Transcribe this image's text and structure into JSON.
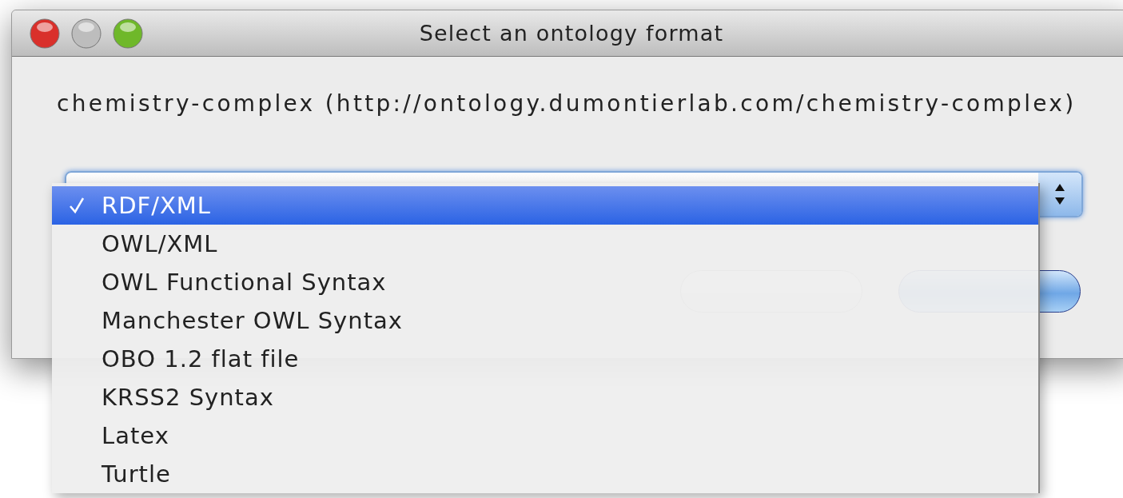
{
  "window": {
    "title": "Select an ontology format"
  },
  "description": "chemistry-complex (http://ontology.dumontierlab.com/chemistry-complex)",
  "format_menu": {
    "items": [
      {
        "label": "RDF/XML",
        "selected": true
      },
      {
        "label": "OWL/XML",
        "selected": false
      },
      {
        "label": "OWL Functional Syntax",
        "selected": false
      },
      {
        "label": "Manchester OWL Syntax",
        "selected": false
      },
      {
        "label": "OBO 1.2 flat file",
        "selected": false
      },
      {
        "label": "KRSS2 Syntax",
        "selected": false
      },
      {
        "label": "Latex",
        "selected": false
      },
      {
        "label": "Turtle",
        "selected": false
      }
    ]
  }
}
